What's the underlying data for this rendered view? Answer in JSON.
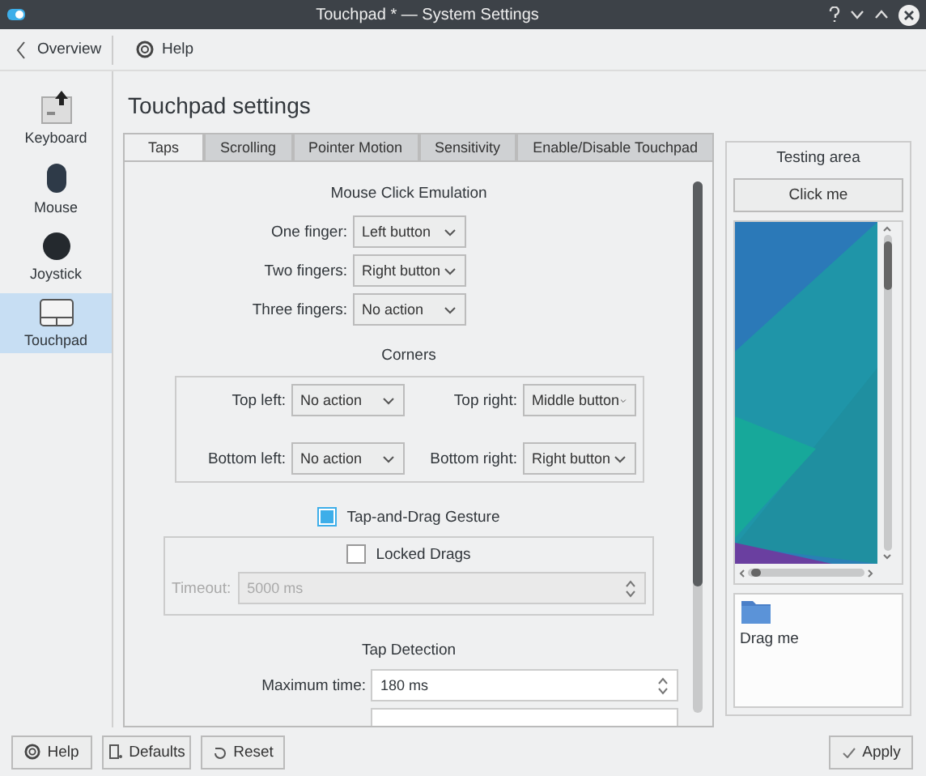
{
  "window": {
    "title": "Touchpad * — System Settings"
  },
  "toolbar": {
    "back_label": "Overview",
    "help_label": "Help"
  },
  "sidebar": {
    "items": [
      {
        "kind": "keyboard",
        "label": "Keyboard",
        "selected": false
      },
      {
        "kind": "mouse",
        "label": "Mouse",
        "selected": false
      },
      {
        "kind": "joystick",
        "label": "Joystick",
        "selected": false
      },
      {
        "kind": "touchpad",
        "label": "Touchpad",
        "selected": true
      }
    ]
  },
  "page_title": "Touchpad settings",
  "tabs": [
    {
      "label": "Taps",
      "selected": true
    },
    {
      "label": "Scrolling",
      "selected": false
    },
    {
      "label": "Pointer Motion",
      "selected": false
    },
    {
      "label": "Sensitivity",
      "selected": false
    },
    {
      "label": "Enable/Disable Touchpad",
      "selected": false
    }
  ],
  "click_emulation": {
    "title": "Mouse Click Emulation",
    "rows": [
      {
        "label": "One finger:",
        "value": "Left button"
      },
      {
        "label": "Two fingers:",
        "value": "Right button"
      },
      {
        "label": "Three fingers:",
        "value": "No action"
      }
    ]
  },
  "corners": {
    "title": "Corners",
    "rows": [
      {
        "label": "Top left:",
        "value": "No action"
      },
      {
        "label": "Top right:",
        "value": "Middle button"
      },
      {
        "label": "Bottom left:",
        "value": "No action"
      },
      {
        "label": "Bottom right:",
        "value": "Right button"
      }
    ]
  },
  "tap_and_drag": {
    "label": "Tap-and-Drag Gesture",
    "checked": true
  },
  "locked_drags": {
    "label": "Locked Drags",
    "checked": false
  },
  "timeout": {
    "label": "Timeout:",
    "value": "5000 ms",
    "disabled": true
  },
  "tap_detection": {
    "title": "Tap Detection",
    "rows": [
      {
        "label": "Maximum time:",
        "value": "180 ms"
      }
    ]
  },
  "testing_area": {
    "title": "Testing area",
    "button": "Click me",
    "drag_label": "Drag me"
  },
  "footer": {
    "help": "Help",
    "defaults": "Defaults",
    "reset": "Reset",
    "apply": "Apply"
  }
}
